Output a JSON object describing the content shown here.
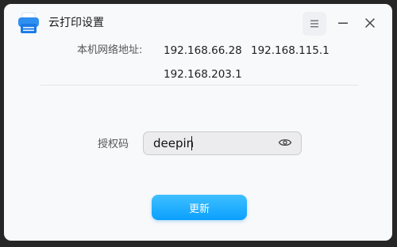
{
  "window": {
    "title": "云打印设置"
  },
  "titlebar": {
    "app_icon": "printer-icon",
    "menu_icon": "menu-icon",
    "minimize_icon": "minimize-icon",
    "close_icon": "close-icon"
  },
  "network": {
    "label": "本机网络地址:",
    "addresses": [
      "192.168.66.28",
      "192.168.115.1",
      "192.168.203.1"
    ]
  },
  "auth": {
    "label": "授权码",
    "value": "deepin",
    "toggle_icon": "eye-icon"
  },
  "actions": {
    "update_label": "更新"
  },
  "colors": {
    "accent": "#1aa9ff",
    "window_bg": "#f8f9fb",
    "outer_bg": "#262626"
  }
}
